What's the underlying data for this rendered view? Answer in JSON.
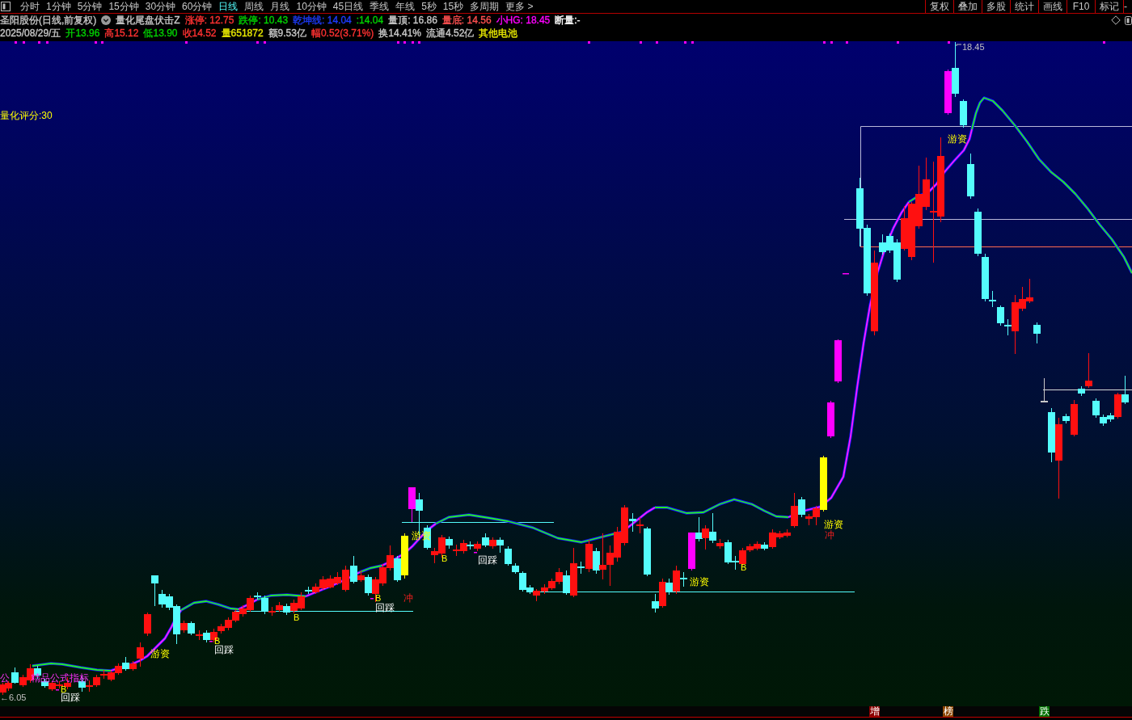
{
  "toolbar": {
    "tabs": [
      {
        "label": "分时",
        "selected": false
      },
      {
        "label": "1分钟",
        "selected": false
      },
      {
        "label": "5分钟",
        "selected": false
      },
      {
        "label": "15分钟",
        "selected": false
      },
      {
        "label": "30分钟",
        "selected": false
      },
      {
        "label": "60分钟",
        "selected": false
      },
      {
        "label": "日线",
        "selected": true
      },
      {
        "label": "周线",
        "selected": false
      },
      {
        "label": "月线",
        "selected": false
      },
      {
        "label": "10分钟",
        "selected": false
      },
      {
        "label": "45日线",
        "selected": false
      },
      {
        "label": "季线",
        "selected": false
      },
      {
        "label": "年线",
        "selected": false
      },
      {
        "label": "5秒",
        "selected": false
      },
      {
        "label": "15秒",
        "selected": false
      },
      {
        "label": "多周期",
        "selected": false
      },
      {
        "label": "更多 >",
        "selected": false
      }
    ],
    "tools": [
      "复权",
      "叠加",
      "多股",
      "统计",
      "画线",
      "F10",
      "标记",
      "-"
    ]
  },
  "indicator_row": {
    "title": "圣阳股份(日线,前复权)",
    "formula": "量化尾盘伏击Z",
    "values": [
      {
        "text": "涨停: 12.75",
        "color": "#ff3232"
      },
      {
        "text": "跌停: 10.43",
        "color": "#00d200"
      },
      {
        "text": "乾坤线: 14.04",
        "color": "#1e3cff"
      },
      {
        "text": ":14.04",
        "color": "#00d200"
      },
      {
        "text": "量顶: 16.86",
        "color": "#c8c8c8"
      },
      {
        "text": "量底: 14.56",
        "color": "#ff5050"
      },
      {
        "text": "小HG: 18.45",
        "color": "#ff00ff"
      },
      {
        "text": "断量:-",
        "color": "#ffffff"
      }
    ]
  },
  "quote_row": {
    "items": [
      {
        "text": "2025/08/29/五",
        "color": "#c8c8c8"
      },
      {
        "text": "开13.96",
        "color": "#00d200"
      },
      {
        "text": "高15.12",
        "color": "#ff3232"
      },
      {
        "text": "低13.90",
        "color": "#00d200"
      },
      {
        "text": "收14.52",
        "color": "#ff3232"
      },
      {
        "text": "量651872",
        "color": "#e8e800"
      },
      {
        "text": "额9.53亿",
        "color": "#c8c8c8"
      },
      {
        "text": "幅0.52(3.71%)",
        "color": "#ff3232"
      },
      {
        "text": "换14.41%",
        "color": "#c8c8c8"
      },
      {
        "text": "流通4.52亿",
        "color": "#c8c8c8"
      },
      {
        "text": "其他电池",
        "color": "#e8e800"
      }
    ]
  },
  "chart": {
    "score": "量化评分:30",
    "high_marker": "18.45",
    "low_marker": "←6.05",
    "legend": [
      "公",
      "精品公式指标"
    ],
    "signals": [
      {
        "kind": "buy",
        "text": "B"
      },
      {
        "kind": "pullback",
        "text": "回踩"
      },
      {
        "kind": "hot_money",
        "text": "游资"
      },
      {
        "kind": "buy",
        "text": "B"
      },
      {
        "kind": "pullback",
        "text": "回踩"
      },
      {
        "kind": "buy",
        "text": "B"
      },
      {
        "kind": "buy",
        "text": "B"
      },
      {
        "kind": "pullback",
        "text": "回踩"
      },
      {
        "kind": "rush",
        "text": "冲"
      },
      {
        "kind": "hot_money",
        "text": "游资"
      },
      {
        "kind": "buy",
        "text": "B"
      },
      {
        "kind": "pullback",
        "text": "回踩"
      },
      {
        "kind": "hot_money",
        "text": "游资"
      },
      {
        "kind": "buy",
        "text": "B"
      },
      {
        "kind": "hot_money",
        "text": "游资"
      },
      {
        "kind": "rush",
        "text": "冲"
      },
      {
        "kind": "hot_money",
        "text": "游资"
      }
    ]
  },
  "bottom_badges": [
    {
      "text": "增",
      "color": "#8b0000"
    },
    {
      "text": "榜",
      "color": "#8b4500"
    },
    {
      "text": "跌",
      "color": "#007000"
    }
  ]
}
